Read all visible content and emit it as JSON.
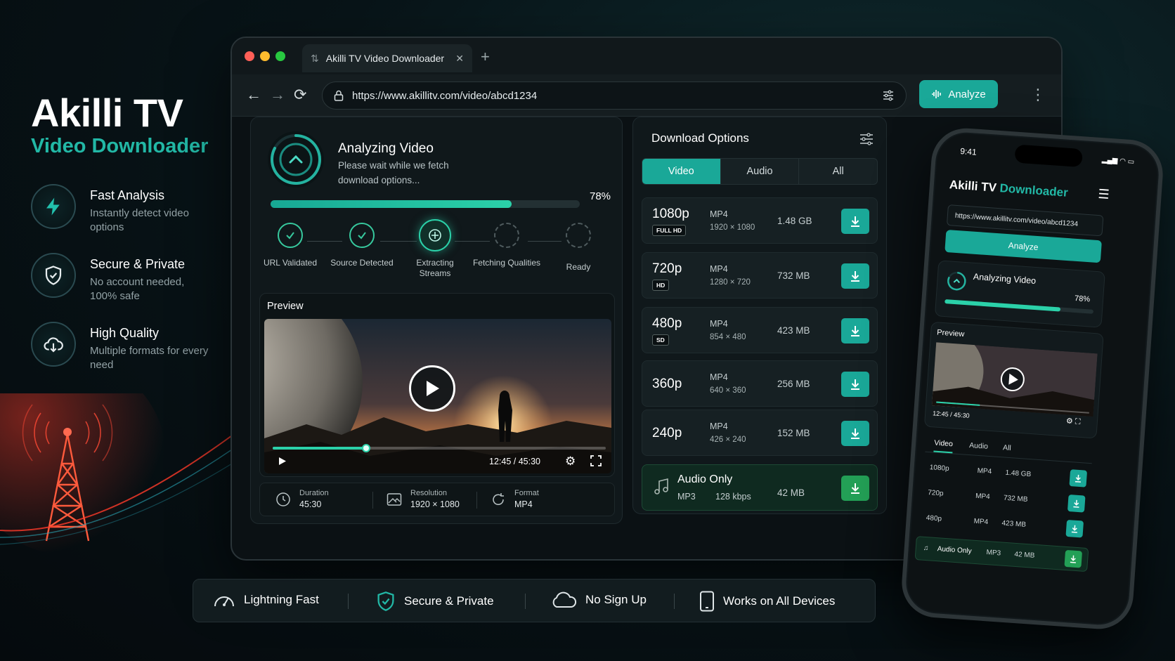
{
  "hero": {
    "title": "Akilli TV",
    "subtitle": "Video Downloader",
    "features": [
      {
        "icon": "lightning-icon",
        "title": "Fast Analysis",
        "desc": "Instantly detect video options"
      },
      {
        "icon": "shield-icon",
        "title": "Secure & Private",
        "desc": "No account needed, 100% safe"
      },
      {
        "icon": "cloud-download-icon",
        "title": "High Quality",
        "desc": "Multiple formats for every need"
      }
    ]
  },
  "browser": {
    "tab_title": "Akilli TV Video Downloader",
    "url": "https://www.akillitv.com/video/abcd1234",
    "analyze_label": "Analyze"
  },
  "analysis": {
    "title": "Analyzing Video",
    "desc": "Please wait while we fetch download options...",
    "progress": 0.78,
    "progress_label": "78%",
    "steps": [
      {
        "label": "URL Validated",
        "state": "done"
      },
      {
        "label": "Source Detected",
        "state": "done"
      },
      {
        "label": "Extracting Streams",
        "state": "active"
      },
      {
        "label": "Fetching Qualities",
        "state": "pending"
      },
      {
        "label": "Ready",
        "state": "pending"
      }
    ]
  },
  "preview": {
    "label": "Preview",
    "time": "12:45 / 45:30",
    "played": 0.28
  },
  "meta": {
    "duration_label": "Duration",
    "duration": "45:30",
    "resolution_label": "Resolution",
    "resolution": "1920 × 1080",
    "format_label": "Format",
    "format": "MP4"
  },
  "download": {
    "title": "Download Options",
    "tabs": [
      "Video",
      "Audio",
      "All"
    ],
    "active_tab": "Video",
    "rows": [
      {
        "res": "1080p",
        "badge": "FULL HD",
        "format": "MP4",
        "dims": "1920 × 1080",
        "size": "1.48 GB"
      },
      {
        "res": "720p",
        "badge": "HD",
        "format": "MP4",
        "dims": "1280 × 720",
        "size": "732 MB"
      },
      {
        "res": "480p",
        "badge": "SD",
        "format": "MP4",
        "dims": "854 × 480",
        "size": "423 MB"
      },
      {
        "res": "360p",
        "badge": "",
        "format": "MP4",
        "dims": "640 × 360",
        "size": "256 MB"
      },
      {
        "res": "240p",
        "badge": "",
        "format": "MP4",
        "dims": "426 × 240",
        "size": "152 MB"
      }
    ],
    "audio": {
      "title": "Audio Only",
      "format": "MP3",
      "bitrate": "128 kbps",
      "size": "42 MB"
    }
  },
  "phone": {
    "time": "9:41",
    "title_a": "Akilli TV",
    "title_b": "Downloader",
    "url": "https://www.akillitv.com/video/abcd1234",
    "analyze_label": "Analyze",
    "analyzing": "Analyzing Video",
    "pct": "78%",
    "preview": "Preview",
    "time_code": "12:45 / 45:30",
    "tabs": [
      "Video",
      "Audio",
      "All"
    ],
    "rows": [
      {
        "res": "1080p",
        "format": "MP4",
        "size": "1.48 GB"
      },
      {
        "res": "720p",
        "format": "MP4",
        "size": "732 MB"
      },
      {
        "res": "480p",
        "format": "MP4",
        "size": "423 MB"
      }
    ],
    "audio": {
      "title": "Audio Only",
      "format": "MP3",
      "size": "42 MB"
    }
  },
  "bottom": [
    {
      "icon": "speedometer-icon",
      "label": "Lightning Fast"
    },
    {
      "icon": "shield-check-icon",
      "label": "Secure & Private"
    },
    {
      "icon": "cloud-icon",
      "label": "No Sign Up"
    },
    {
      "icon": "phone-icon",
      "label": "Works on All Devices"
    }
  ],
  "colors": {
    "accent": "#1aa898",
    "accent_light": "#2bd1a9",
    "audio_green": "#23a056",
    "background": "#050a0d"
  }
}
